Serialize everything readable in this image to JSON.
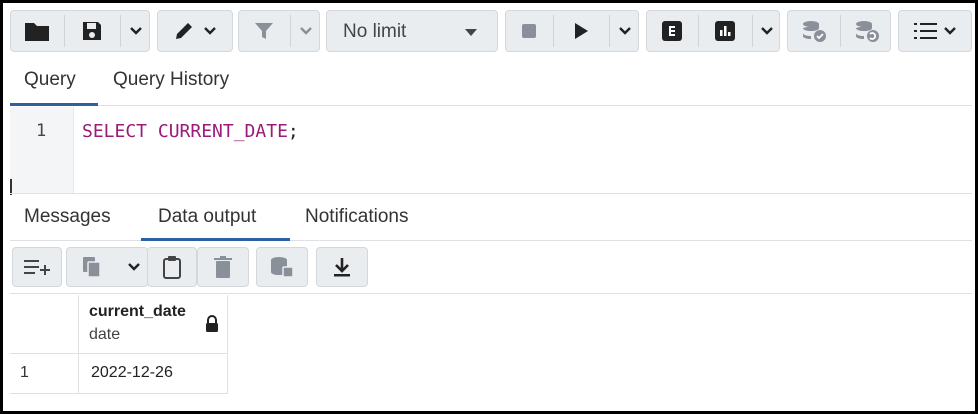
{
  "toolbar": {
    "limit_select_value": "No limit",
    "icons": [
      "folder-icon",
      "save-icon",
      "chevron-down-icon",
      "pen-icon",
      "filter-icon",
      "stop-icon",
      "play-icon",
      "explain-icon",
      "explain-analyze-icon",
      "commit-icon",
      "rollback-icon",
      "macros-icon"
    ]
  },
  "query_tabs": [
    {
      "label": "Query",
      "active": true
    },
    {
      "label": "Query History",
      "active": false
    }
  ],
  "editor": {
    "line_number": "1",
    "keyword": "SELECT CURRENT_DATE",
    "terminator": ";"
  },
  "result_tabs": [
    {
      "label": "Messages",
      "active": false
    },
    {
      "label": "Data output",
      "active": true
    },
    {
      "label": "Notifications",
      "active": false
    }
  ],
  "grid": {
    "columns": [
      {
        "name": "current_date",
        "type": "date"
      }
    ],
    "rows": [
      {
        "row_number": "1",
        "values": [
          "2022-12-26"
        ]
      }
    ]
  },
  "colors": {
    "keyword": "#9b1a7a",
    "active_tab_underline": "#2d5fa3",
    "button_bg": "#eaedf0"
  }
}
